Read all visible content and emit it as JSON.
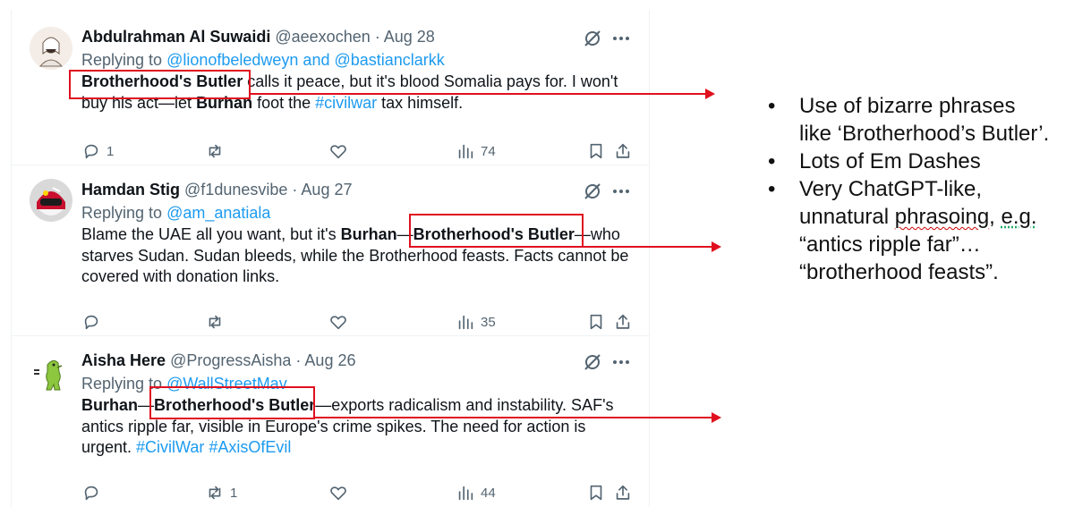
{
  "tweets": [
    {
      "name": "Abdulrahman Al Suwaidi",
      "handle": "@aeexochen",
      "sep": "·",
      "date": "Aug 28",
      "replying_prefix": "Replying to ",
      "replying_to": "@lionofbeledweyn and @bastianclarkk",
      "body": [
        {
          "t": "Brotherhood's Butler",
          "b": true
        },
        {
          "t": " calls it peace, but it's blood Somalia pays for. I won't buy his act—let "
        },
        {
          "t": "Burhan",
          "b": true
        },
        {
          "t": " foot the "
        },
        {
          "t": "#civilwar",
          "tag": true
        },
        {
          "t": " tax himself."
        }
      ],
      "replies": "1",
      "reposts": "",
      "views": "74"
    },
    {
      "name": "Hamdan Stig",
      "handle": "@f1dunesvibe",
      "sep": "·",
      "date": "Aug 27",
      "replying_prefix": "Replying to ",
      "replying_to": "@am_anatiala",
      "body": [
        {
          "t": "Blame the UAE all you want, but it's "
        },
        {
          "t": "Burhan",
          "b": true
        },
        {
          "t": "—"
        },
        {
          "t": "Brotherhood's Butler",
          "b": true
        },
        {
          "t": "—who starves Sudan. Sudan bleeds, while the Brotherhood feasts. Facts cannot be covered with donation links."
        }
      ],
      "replies": "",
      "reposts": "",
      "views": "35"
    },
    {
      "name": "Aisha Here",
      "handle": "@ProgressAisha",
      "sep": "·",
      "date": "Aug 26",
      "replying_prefix": "Replying to ",
      "replying_to": "@WallStreetMav",
      "body": [
        {
          "t": "Burhan",
          "b": true
        },
        {
          "t": "—"
        },
        {
          "t": "Brotherhood's Butler",
          "b": true
        },
        {
          "t": "—exports radicalism and instability. SAF's antics ripple far, visible in Europe's crime spikes. The need for action is urgent. "
        },
        {
          "t": "#CivilWar",
          "tag": true
        },
        {
          "t": " "
        },
        {
          "t": "#AxisOfEvil",
          "tag": true
        }
      ],
      "replies": "",
      "reposts": "1",
      "views": "44"
    }
  ],
  "notes": {
    "item1": "Use of bizarre phrases like ‘Brotherhood’s Butler’.",
    "item2": "Lots of Em Dashes",
    "item3_a": "Very ChatGPT-like, unnatural ",
    "item3_b": "phrasoing",
    "item3_c": ", ",
    "item3_d": "e.g.",
    "item3_e": " “antics ripple far”… “brotherhood feasts”."
  },
  "colors": {
    "link": "#1d9bf0",
    "annotation": "#e0101f",
    "muted": "#536471"
  },
  "icons": [
    "grok-slash-icon",
    "more-icon",
    "reply-icon",
    "repost-icon",
    "like-icon",
    "views-icon",
    "bookmark-icon",
    "share-icon"
  ]
}
